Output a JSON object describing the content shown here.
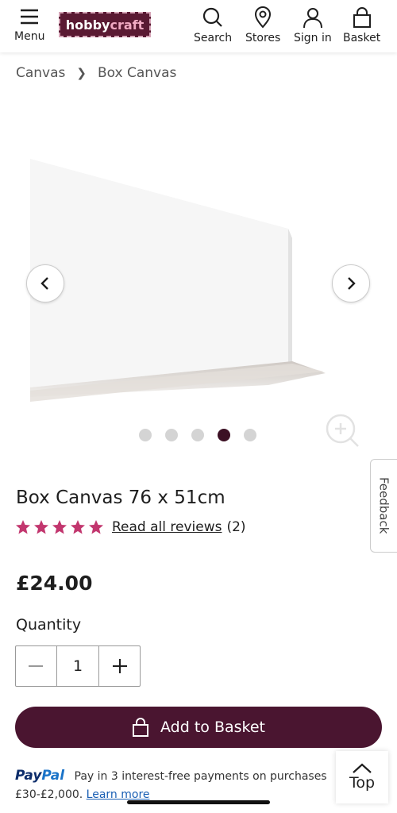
{
  "header": {
    "menu_label": "Menu",
    "logo_part1": "hobby",
    "logo_part2": "craft",
    "search_label": "Search",
    "stores_label": "Stores",
    "signin_label": "Sign in",
    "basket_label": "Basket"
  },
  "breadcrumb": {
    "items": [
      "Canvas",
      "Box Canvas"
    ]
  },
  "gallery": {
    "image_count": 5,
    "active_index": 3
  },
  "feedback_label": "Feedback",
  "product": {
    "title": "Box Canvas 76 x 51cm",
    "rating_stars": 5,
    "reviews_link": "Read all reviews",
    "reviews_count": "(2)",
    "price": "£24.00"
  },
  "quantity": {
    "label": "Quantity",
    "value": "1"
  },
  "add_to_basket_label": "Add to Basket",
  "paypal": {
    "logo_text_1": "Pay",
    "logo_text_2": "Pal",
    "message": "Pay in 3 interest-free payments on purchases £30-£2,000.",
    "link": "Learn more"
  },
  "top_button_label": "Top",
  "colors": {
    "brand": "#4a1530",
    "star": "#c2366e"
  }
}
